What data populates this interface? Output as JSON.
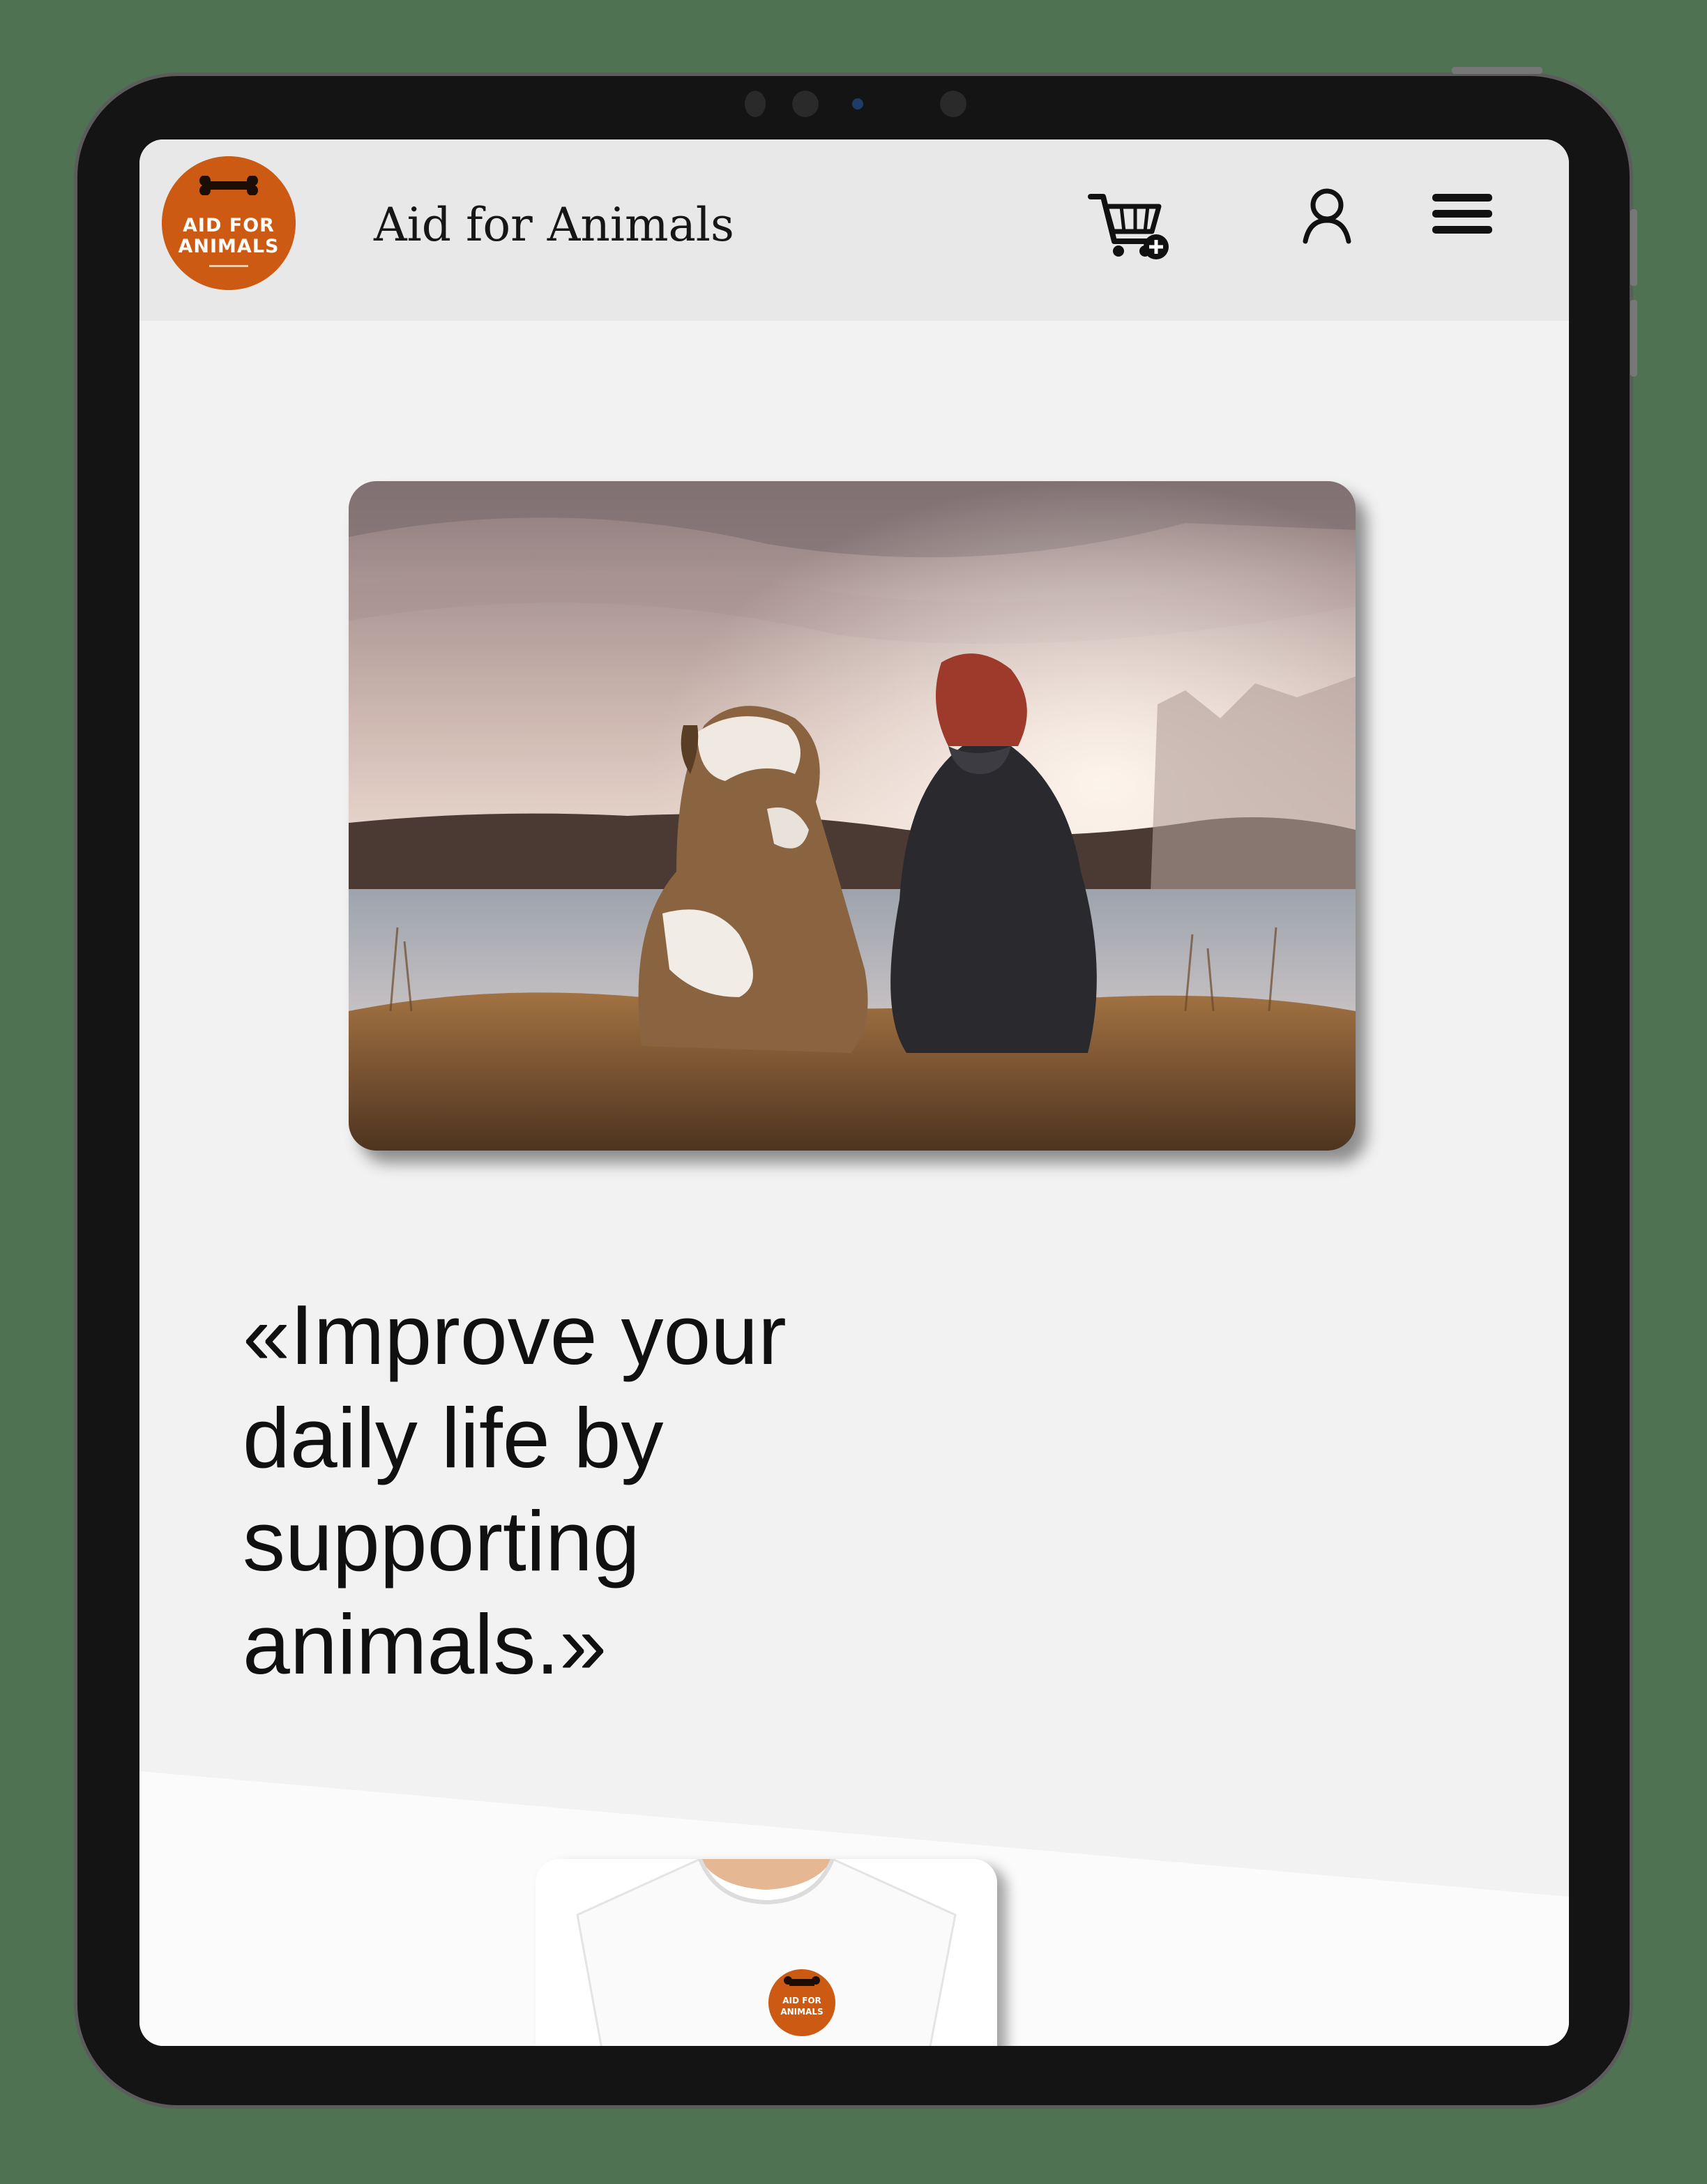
{
  "header": {
    "logo_line1": "AID FOR",
    "logo_line2": "ANIMALS",
    "site_title": "Aid for Animals",
    "cart_icon": "cart-plus-icon",
    "user_icon": "user-icon",
    "menu_icon": "hamburger-menu-icon"
  },
  "hero": {
    "image_subject": "dog and woman sitting by a lake at sunset",
    "quote": "«Improve your daily life by supporting animals.»"
  },
  "product": {
    "image_subject": "white t-shirt with Aid for Animals logo",
    "logo_line1": "AID FOR",
    "logo_line2": "ANIMALS"
  },
  "colors": {
    "brand_orange": "#cc5a12",
    "header_bg": "#e8e8e8",
    "page_bg": "#f2f2f2"
  }
}
